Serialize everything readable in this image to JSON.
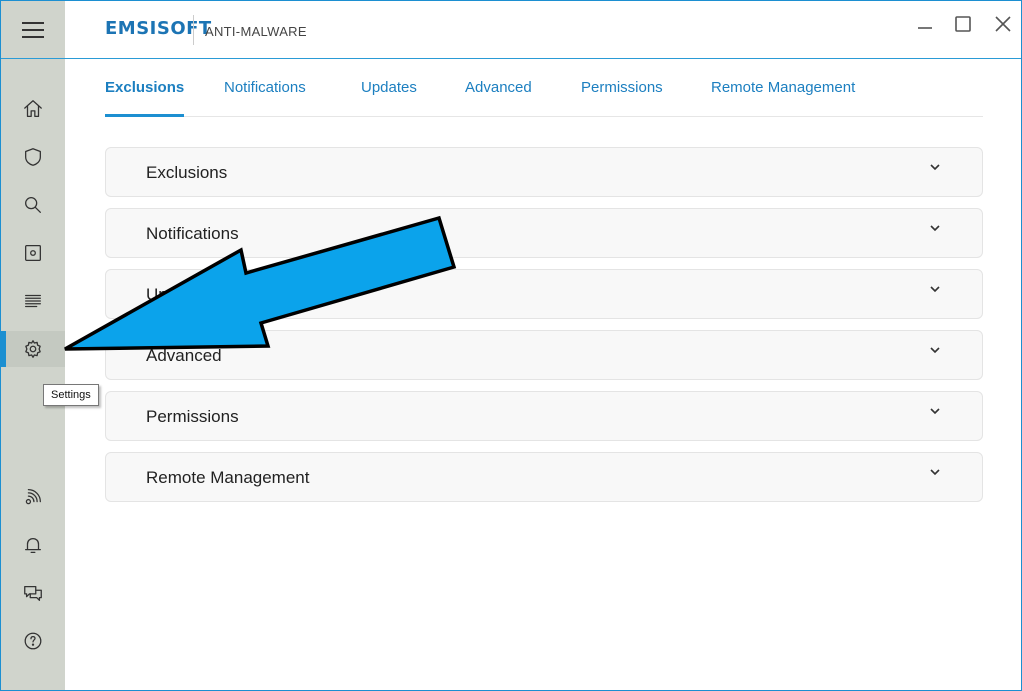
{
  "app": {
    "brand": "EMSISOFT",
    "product": "ANTI-MALWARE"
  },
  "sidebar": {
    "tooltip": "Settings",
    "items": [
      {
        "name": "home",
        "icon": "home-icon"
      },
      {
        "name": "protection",
        "icon": "shield-icon"
      },
      {
        "name": "scan",
        "icon": "search-icon"
      },
      {
        "name": "quarantine",
        "icon": "quarantine-icon"
      },
      {
        "name": "logs",
        "icon": "logs-icon"
      },
      {
        "name": "settings",
        "icon": "gear-icon",
        "active": true
      },
      {
        "name": "cloud-console",
        "icon": "wifi-signal-icon"
      },
      {
        "name": "notifications",
        "icon": "bell-icon"
      },
      {
        "name": "feedback",
        "icon": "chat-icon"
      },
      {
        "name": "help",
        "icon": "help-icon"
      }
    ]
  },
  "tabs": [
    {
      "label": "Exclusions",
      "active": true
    },
    {
      "label": "Notifications"
    },
    {
      "label": "Updates"
    },
    {
      "label": "Advanced"
    },
    {
      "label": "Permissions"
    },
    {
      "label": "Remote Management"
    }
  ],
  "panels": [
    {
      "label": "Exclusions"
    },
    {
      "label": "Notifications"
    },
    {
      "label": "Updates"
    },
    {
      "label": "Advanced"
    },
    {
      "label": "Permissions"
    },
    {
      "label": "Remote Management"
    }
  ],
  "colors": {
    "accent": "#1c8fd1",
    "sidebar": "#d0d4cc",
    "arrow_fill": "#0ba3eb"
  }
}
